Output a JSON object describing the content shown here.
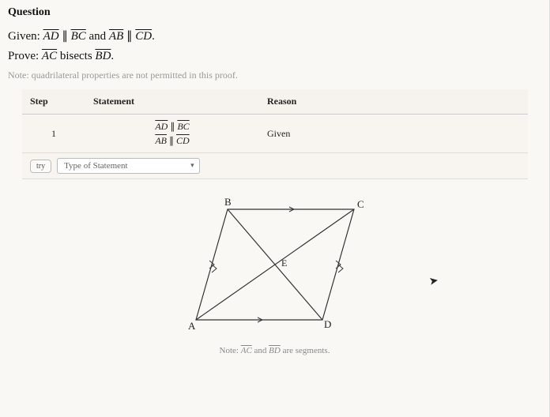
{
  "heading": "Question",
  "given_prefix": "Given: ",
  "given_seg1a": "AD",
  "given_par": " ∥ ",
  "given_seg1b": "BC",
  "given_and": " and ",
  "given_seg2a": "AB",
  "given_seg2b": "CD",
  "given_period": ".",
  "prove_prefix": "Prove: ",
  "prove_seg1": "AC",
  "prove_mid": " bisects ",
  "prove_seg2": "BD",
  "note": "Note: quadrilateral properties are not permitted in this proof.",
  "table": {
    "headers": {
      "step": "Step",
      "statement": "Statement",
      "reason": "Reason"
    },
    "row1": {
      "step": "1",
      "stmt_line1_a": "AD",
      "stmt_par": " ∥ ",
      "stmt_line1_b": "BC",
      "stmt_line2_a": "AB",
      "stmt_line2_b": "CD",
      "reason": "Given"
    },
    "input": {
      "try": "try",
      "placeholder": "Type of Statement"
    }
  },
  "diagram": {
    "labels": {
      "A": "A",
      "B": "B",
      "C": "C",
      "D": "D",
      "E": "E"
    }
  },
  "footnote_prefix": "Note: ",
  "footnote_seg1": "AC",
  "footnote_and": " and ",
  "footnote_seg2": "BD",
  "footnote_suffix": " are segments."
}
